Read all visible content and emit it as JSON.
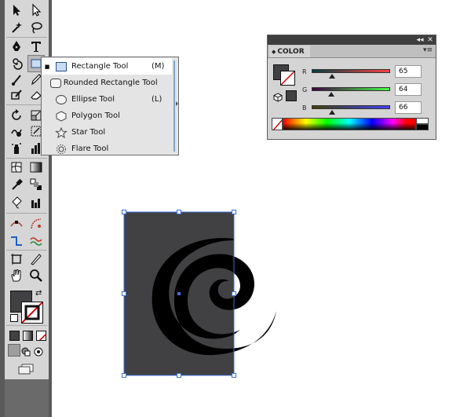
{
  "flyout": {
    "items": [
      {
        "label": "Rectangle Tool",
        "shortcut": "(M)",
        "selected": true,
        "icon": "rectangle-icon"
      },
      {
        "label": "Rounded Rectangle Tool",
        "shortcut": "",
        "icon": "rounded-rectangle-icon"
      },
      {
        "label": "Ellipse Tool",
        "shortcut": "(L)",
        "icon": "ellipse-icon"
      },
      {
        "label": "Polygon Tool",
        "shortcut": "",
        "icon": "polygon-icon"
      },
      {
        "label": "Star Tool",
        "shortcut": "",
        "icon": "star-icon"
      },
      {
        "label": "Flare Tool",
        "shortcut": "",
        "icon": "flare-icon"
      }
    ]
  },
  "color_panel": {
    "tab_label": "COLOR",
    "collapse_glyph": "◂◂",
    "close_glyph": "✕",
    "menu_glyph": "▾≡",
    "channels": [
      {
        "name": "R",
        "value": "65",
        "fraction": 0.255
      },
      {
        "name": "G",
        "value": "64",
        "fraction": 0.251
      },
      {
        "name": "B",
        "value": "66",
        "fraction": 0.259
      }
    ],
    "fill_color": "#414042"
  },
  "colors": {
    "toolbar_bg": "#d6d6d6",
    "panel_bg": "#d4d4d4",
    "art_fill": "#414042",
    "spiral": "#000000",
    "selection": "#3a6fd8"
  }
}
